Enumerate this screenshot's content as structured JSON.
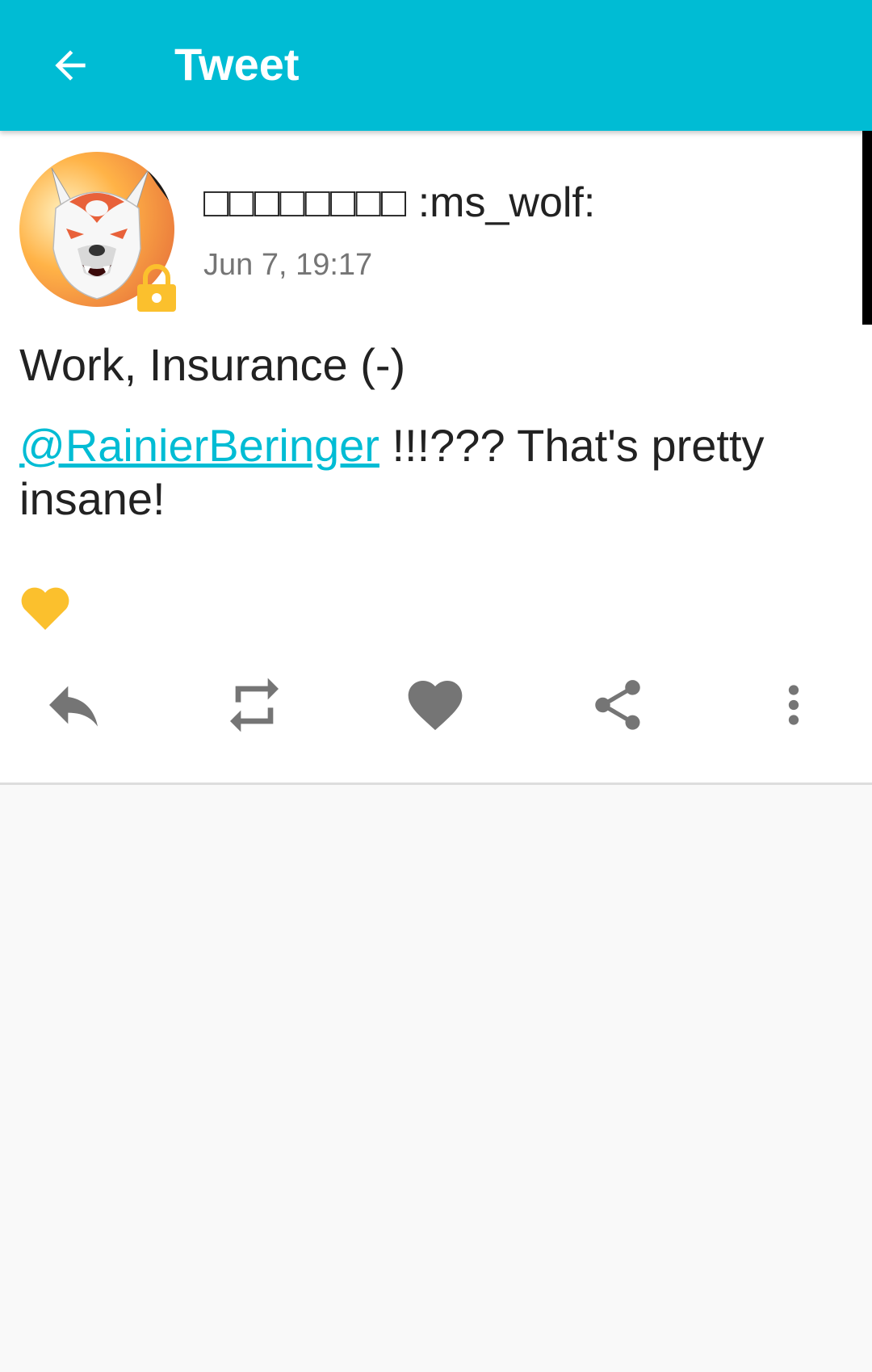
{
  "appbar": {
    "title": "Tweet",
    "back_icon": "arrow-left-icon",
    "background_color": "#00bcd4"
  },
  "status": {
    "display_name": "□□□□□□□□ :ms_wolf:",
    "timestamp": "Jun 7, 19:17",
    "locked_icon": "lock-icon",
    "content_warning": "Work, Insurance (-)",
    "mention": "@RainierBeringer",
    "text_after_mention": " !!!??? That's pretty insane!",
    "reaction_icon": "yellow-heart-icon",
    "mention_color": "#00bcd4",
    "lock_color": "#fbc02d"
  },
  "actions": [
    {
      "name": "reply",
      "icon": "reply-icon"
    },
    {
      "name": "boost",
      "icon": "repeat-icon"
    },
    {
      "name": "favourite",
      "icon": "heart-icon"
    },
    {
      "name": "share",
      "icon": "share-icon"
    },
    {
      "name": "more",
      "icon": "more-vertical-icon"
    }
  ]
}
